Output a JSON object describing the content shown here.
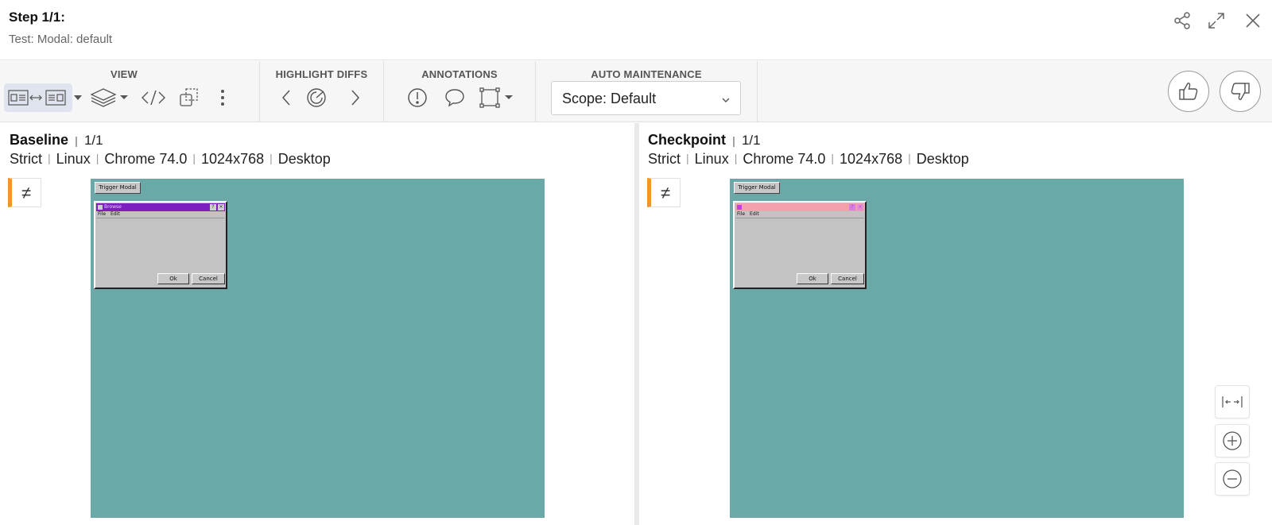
{
  "header": {
    "step_title": "Step 1/1:",
    "test_name": "Test: Modal: default",
    "icons": [
      "share-icon",
      "expand-icon",
      "close-icon"
    ]
  },
  "toolbar": {
    "view": {
      "title": "VIEW",
      "icons": [
        "side-by-side-icon",
        "layers-icon",
        "code-icon",
        "copy-diff-icon",
        "more-icon"
      ]
    },
    "highlight_diffs": {
      "title": "HIGHLIGHT DIFFS",
      "icons": [
        "chevron-left-icon",
        "target-icon",
        "chevron-right-icon"
      ]
    },
    "annotations": {
      "title": "ANNOTATIONS",
      "icons": [
        "exclamation-icon",
        "comment-icon",
        "region-icon"
      ]
    },
    "auto_maintenance": {
      "title": "AUTO MAINTENANCE",
      "scope_value": "Scope: Default"
    },
    "actions": [
      "thumbs-up-icon",
      "thumbs-down-icon"
    ]
  },
  "baseline": {
    "name": "Baseline",
    "count": "1/1",
    "meta": [
      "Strict",
      "Linux",
      "Chrome 74.0",
      "1024x768",
      "Desktop"
    ],
    "diff_symbol": "≠",
    "screen": {
      "trigger_label": "Trigger Modal",
      "modal_title": "Browse",
      "menu": [
        "File",
        "Edit"
      ],
      "ok_label": "Ok",
      "cancel_label": "Cancel",
      "title_bar_color": "#7b1fbe",
      "background_color": "#6ba8a8"
    }
  },
  "checkpoint": {
    "name": "Checkpoint",
    "count": "1/1",
    "meta": [
      "Strict",
      "Linux",
      "Chrome 74.0",
      "1024x768",
      "Desktop"
    ],
    "diff_symbol": "≠",
    "screen": {
      "trigger_label": "Trigger Modal",
      "modal_title": "",
      "menu": [
        "File",
        "Edit"
      ],
      "ok_label": "Ok",
      "cancel_label": "Cancel",
      "title_bar_color": "#f4a0ad",
      "background_color": "#6ba8a8"
    }
  },
  "zoom_tools": [
    "fit-width-icon",
    "zoom-in-icon",
    "zoom-out-icon"
  ],
  "colors": {
    "accent": "#f0962c",
    "active_view": "#dfe4ee"
  }
}
